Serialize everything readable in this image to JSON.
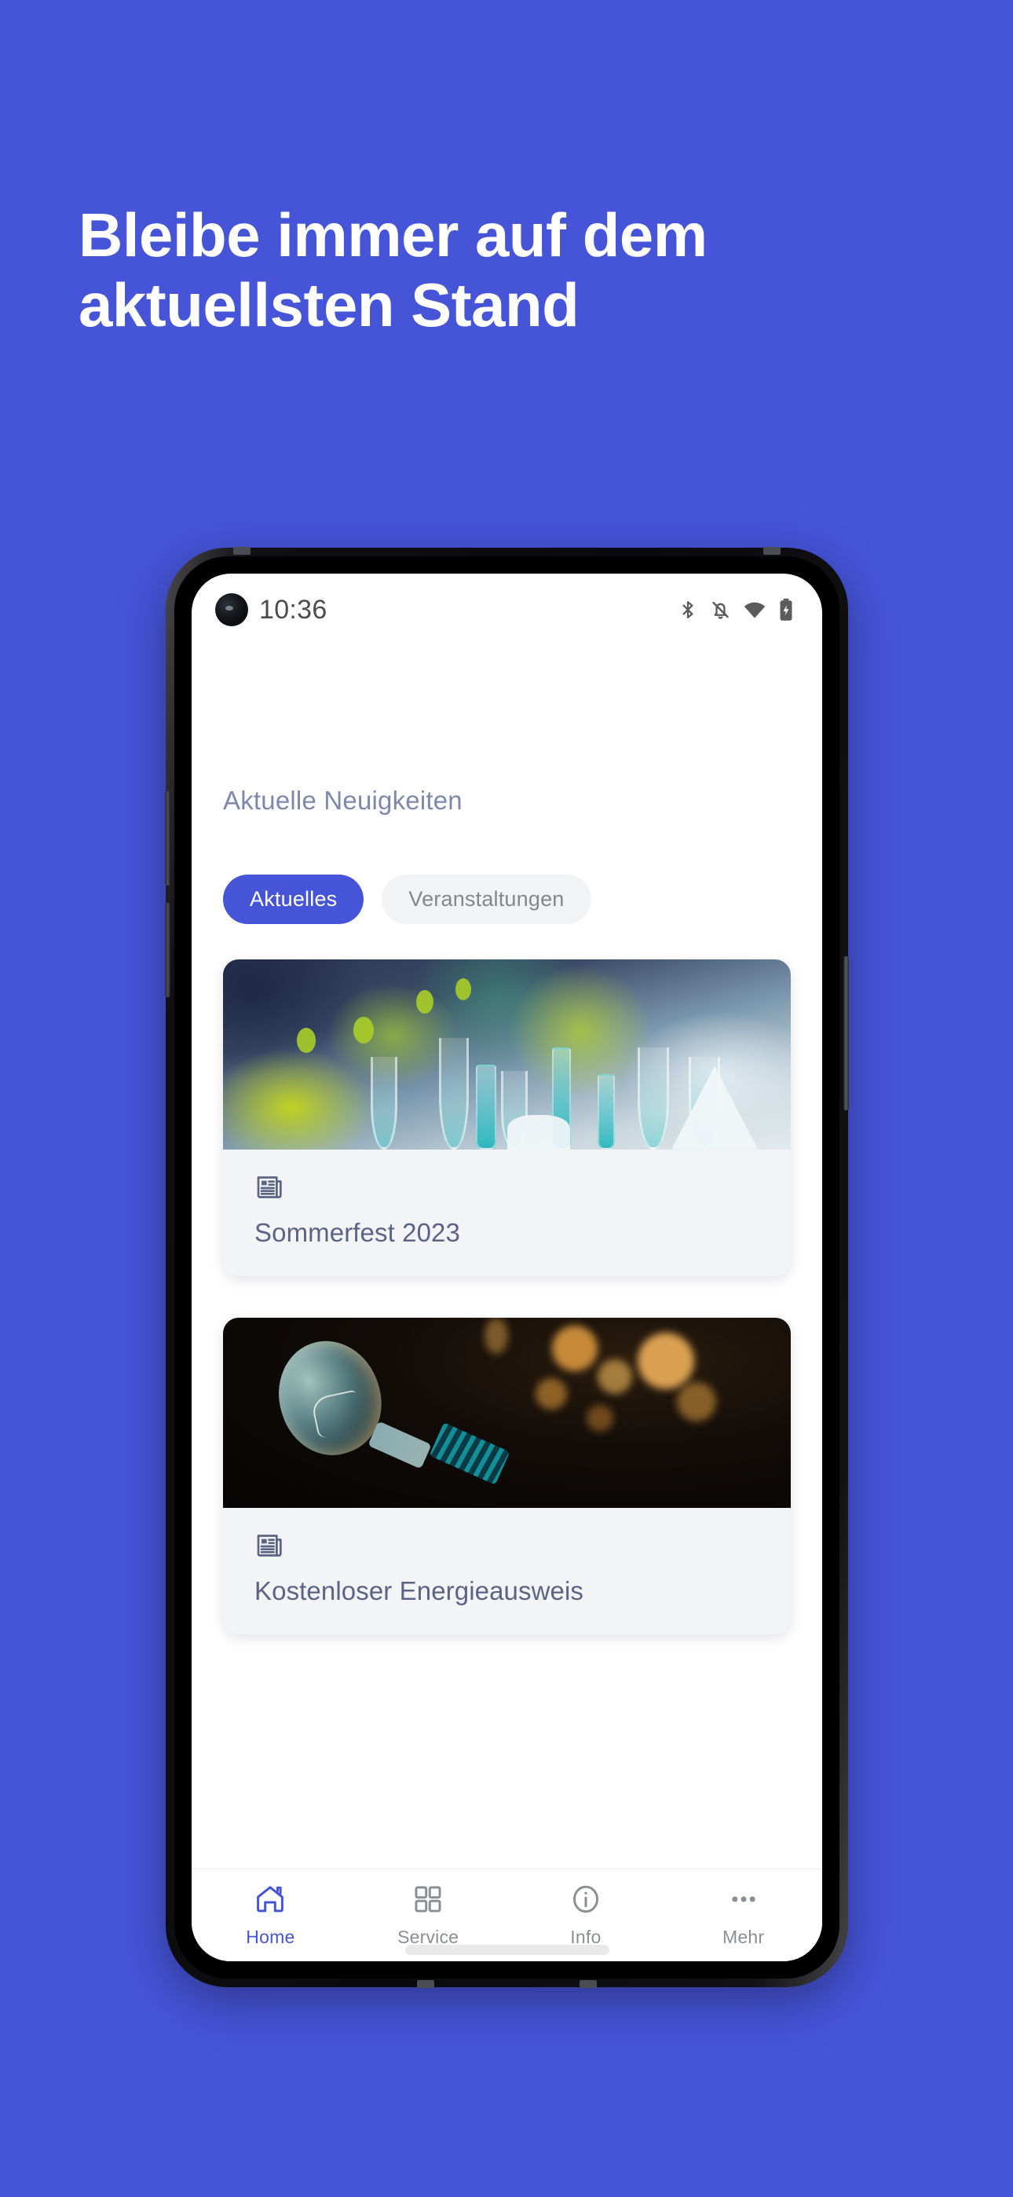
{
  "promo": {
    "headline": "Bleibe immer auf dem\naktuellsten Stand",
    "background_color": "#4654d8",
    "headline_color": "#ffffff"
  },
  "phone": {
    "status_bar": {
      "time": "10:36",
      "icons": [
        "bluetooth-icon",
        "bell-muted-icon",
        "wifi-icon",
        "battery-charging-icon"
      ],
      "punchhole": "front-camera"
    },
    "home_indicator": "gesture-bar"
  },
  "app": {
    "section_title": "Aktuelle Neuigkeiten",
    "accent_color": "#4654d8",
    "tabs": [
      {
        "label": "Aktuelles",
        "active": true
      },
      {
        "label": "Veranstaltungen",
        "active": false
      }
    ],
    "cards": [
      {
        "title": "Sommerfest 2023",
        "icon": "newspaper-icon",
        "photo": "banquet-table-with-champagne-glasses-and-green-flowers"
      },
      {
        "title": "Kostenloser Energieausweis",
        "icon": "newspaper-icon",
        "photo": "vintage-light-bulb-with-orange-bokeh"
      }
    ],
    "bottom_nav": [
      {
        "label": "Home",
        "icon": "house-icon",
        "active": true
      },
      {
        "label": "Service",
        "icon": "grid-icon",
        "active": false
      },
      {
        "label": "Info",
        "icon": "info-circle-icon",
        "active": false
      },
      {
        "label": "Mehr",
        "icon": "ellipsis-icon",
        "active": false
      }
    ]
  }
}
